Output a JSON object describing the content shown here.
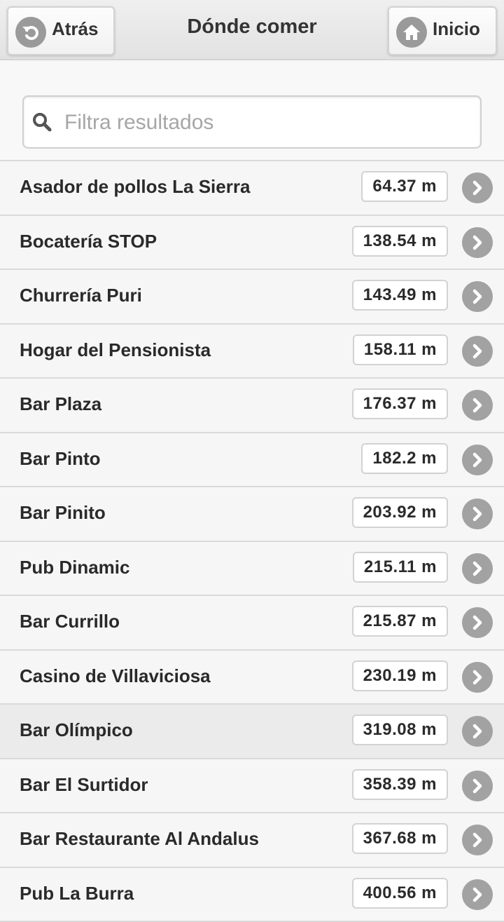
{
  "header": {
    "title": "Dónde comer",
    "back_label": "Atrás",
    "home_label": "Inicio"
  },
  "search": {
    "placeholder": "Filtra resultados",
    "value": ""
  },
  "colors": {
    "header_bg": "#e6e6e6",
    "icon_bg": "#9a9a9a",
    "text": "#2a2a2a",
    "selected_row_bg": "#ebebeb"
  },
  "items": [
    {
      "name": "Asador de pollos La Sierra",
      "distance": "64.37 m"
    },
    {
      "name": "Bocatería STOP",
      "distance": "138.54 m"
    },
    {
      "name": "Churrería Puri",
      "distance": "143.49 m"
    },
    {
      "name": "Hogar del Pensionista",
      "distance": "158.11 m"
    },
    {
      "name": "Bar Plaza",
      "distance": "176.37 m"
    },
    {
      "name": "Bar Pinto",
      "distance": "182.2 m"
    },
    {
      "name": "Bar Pinito",
      "distance": "203.92 m"
    },
    {
      "name": "Pub Dinamic",
      "distance": "215.11 m"
    },
    {
      "name": "Bar Currillo",
      "distance": "215.87 m"
    },
    {
      "name": "Casino de Villaviciosa",
      "distance": "230.19 m"
    },
    {
      "name": "Bar Olímpico",
      "distance": "319.08 m",
      "selected": true
    },
    {
      "name": "Bar El Surtidor",
      "distance": "358.39 m"
    },
    {
      "name": "Bar Restaurante Al Andalus",
      "distance": "367.68 m"
    },
    {
      "name": "Pub La Burra",
      "distance": "400.56 m"
    }
  ]
}
